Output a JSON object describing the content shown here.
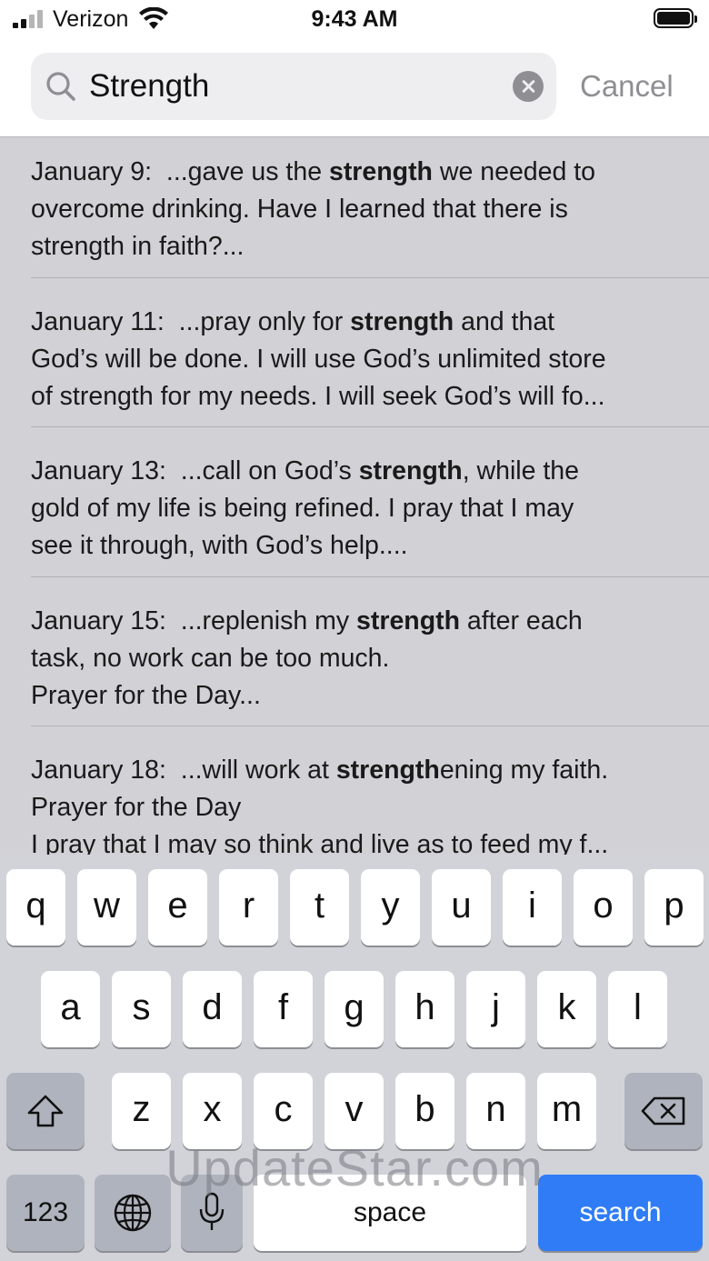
{
  "status_bar": {
    "carrier": "Verizon",
    "time": "9:43 AM"
  },
  "search": {
    "value": "Strength",
    "cancel_label": "Cancel"
  },
  "results": [
    {
      "date": "January 9:",
      "lines": [
        [
          "  ...gave us the ",
          "strength",
          " we needed to"
        ],
        [
          "overcome drinking. Have I learned that there is"
        ],
        [
          "strength in faith?..."
        ]
      ]
    },
    {
      "date": "January 11:",
      "lines": [
        [
          "  ...pray only for ",
          "strength",
          " and that"
        ],
        [
          "God’s will be done. I will use God’s unlimited store"
        ],
        [
          "of strength for my needs. I will seek God’s will fo..."
        ]
      ]
    },
    {
      "date": "January 13:",
      "lines": [
        [
          "  ...call on God’s ",
          "strength",
          ", while the"
        ],
        [
          "gold of my life is being refined. I pray that I may"
        ],
        [
          "see it through, with God’s help...."
        ]
      ]
    },
    {
      "date": "January 15:",
      "lines": [
        [
          "  ...replenish my ",
          "strength",
          " after each"
        ],
        [
          "task, no work can be too much."
        ],
        [
          "Prayer for the Day..."
        ]
      ]
    },
    {
      "date": "January 18:",
      "lines": [
        [
          "  ...will work at ",
          "strength",
          "ening my faith."
        ],
        [
          "Prayer for the Day"
        ],
        [
          "I pray that I may so think and live as to feed my f..."
        ]
      ]
    }
  ],
  "keyboard": {
    "row1": [
      "q",
      "w",
      "e",
      "r",
      "t",
      "y",
      "u",
      "i",
      "o",
      "p"
    ],
    "row2": [
      "a",
      "s",
      "d",
      "f",
      "g",
      "h",
      "j",
      "k",
      "l"
    ],
    "row3": [
      "z",
      "x",
      "c",
      "v",
      "b",
      "n",
      "m"
    ],
    "numbers_label": "123",
    "space_label": "space",
    "search_label": "search"
  },
  "watermark": "UpdateStar.com",
  "colors": {
    "search_key": "#2f7cf6",
    "keyboard_bg": "#d1d3d9",
    "results_bg": "#d1d1d6"
  }
}
